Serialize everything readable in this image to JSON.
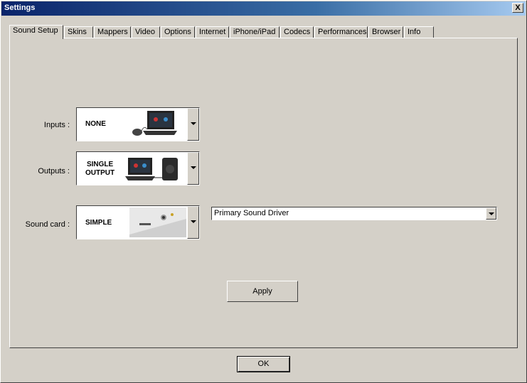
{
  "window": {
    "title": "Settings",
    "close_label": "X"
  },
  "tabs": [
    {
      "label": "Sound Setup",
      "active": true
    },
    {
      "label": "Skins"
    },
    {
      "label": "Mappers"
    },
    {
      "label": "Video"
    },
    {
      "label": "Options"
    },
    {
      "label": "Internet"
    },
    {
      "label": "iPhone/iPad"
    },
    {
      "label": "Codecs"
    },
    {
      "label": "Performances"
    },
    {
      "label": "Browser"
    },
    {
      "label": "Info"
    }
  ],
  "inputs": {
    "label": "Inputs :",
    "value": "NONE"
  },
  "outputs": {
    "label": "Outputs :",
    "value_line1": "SINGLE",
    "value_line2": "OUTPUT"
  },
  "soundcard": {
    "label": "Sound card :",
    "value": "SIMPLE"
  },
  "driver": {
    "value": "Primary Sound Driver"
  },
  "buttons": {
    "apply": "Apply",
    "ok": "OK"
  },
  "colors": {
    "title_start": "#0a246a",
    "title_end": "#a6caf0",
    "face": "#d4d0c8"
  }
}
